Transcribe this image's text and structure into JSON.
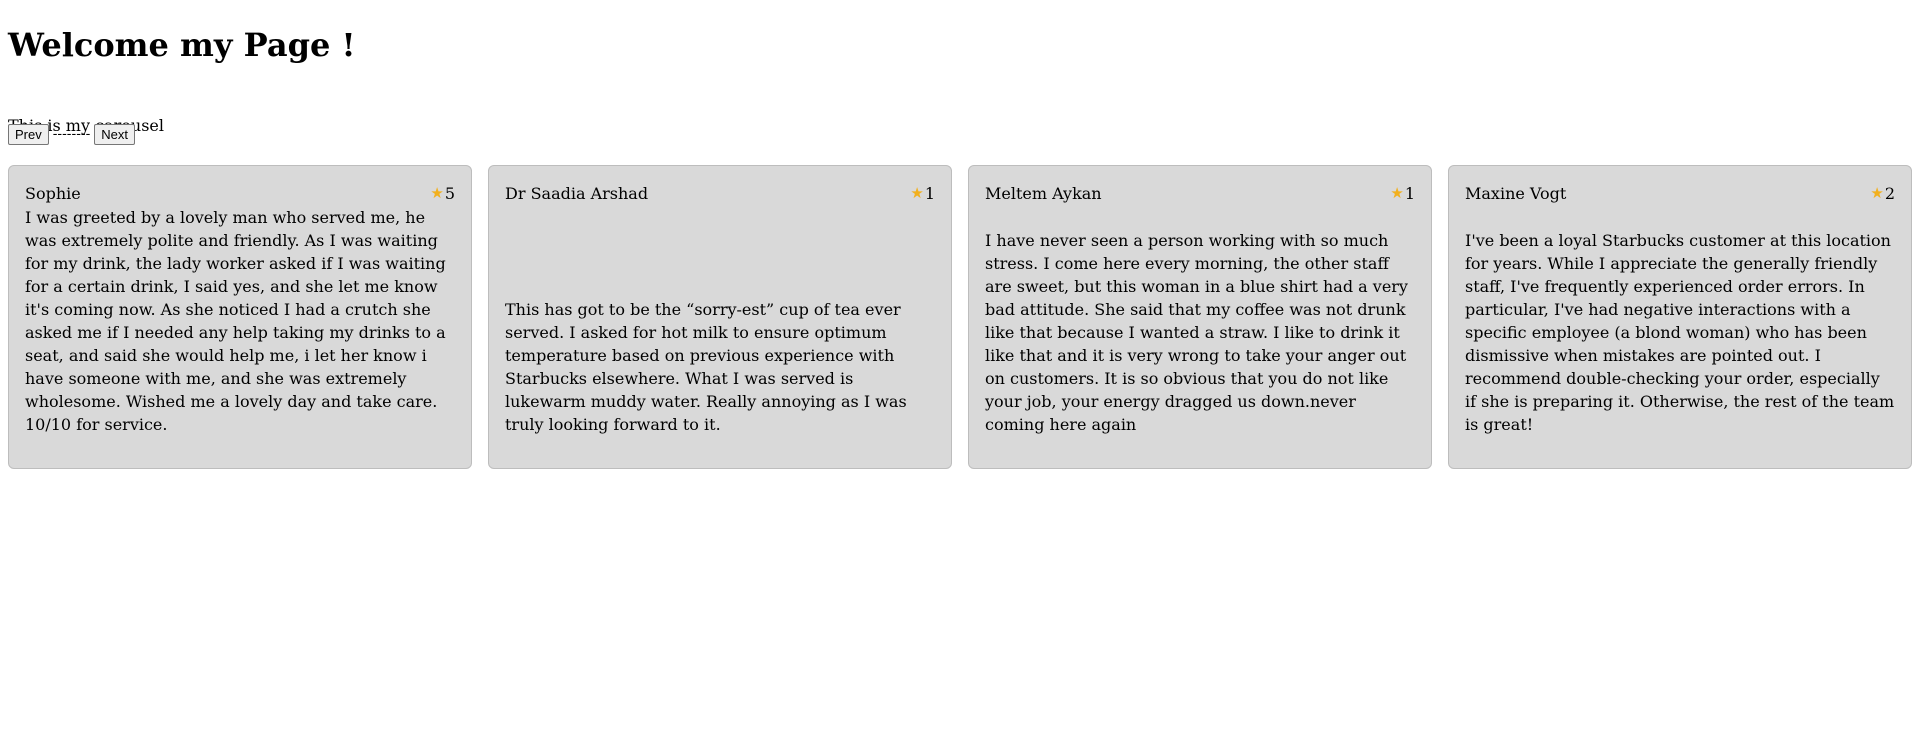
{
  "page": {
    "title": "Welcome my Page !",
    "subtitle": "This is my carousel"
  },
  "controls": {
    "prev_label": "Prev",
    "separator": "--------",
    "next_label": "Next"
  },
  "colors": {
    "card_background": "#d9d9d9",
    "star": "#f2b01e"
  },
  "reviews": [
    {
      "name": "Sophie",
      "star_icon": "star-icon",
      "rating": "5",
      "text": "I was greeted by a lovely man who served me, he was extremely polite and friendly. As I was waiting for my drink, the lady worker asked if I was waiting for a certain drink, I said yes, and she let me know it's coming now. As she noticed I had a crutch she asked me if I needed any help taking my drinks to a seat, and said she would help me, i let her know i have someone with me, and she was extremely wholesome. Wished me a lovely day and take care. 10/10 for service."
    },
    {
      "name": "Dr Saadia Arshad",
      "star_icon": "star-icon",
      "rating": "1",
      "text": "This has got to be the “sorry-est” cup of tea ever served. I asked for hot milk to ensure optimum temperature based on previous experience with Starbucks elsewhere. What I was served is lukewarm muddy water. Really annoying as I was truly looking forward to it."
    },
    {
      "name": "Meltem Aykan",
      "star_icon": "star-icon",
      "rating": "1",
      "text": "I have never seen a person working with so much stress. I come here every morning, the other staff are sweet, but this woman in a blue shirt had a very bad attitude. She said that my coffee was not drunk like that because I wanted a straw. I like to drink it like that and it is very wrong to take your anger out on customers. It is so obvious that you do not like your job, your energy dragged us down.never coming here again"
    },
    {
      "name": "Maxine Vogt",
      "star_icon": "star-icon",
      "rating": "2",
      "text": "I've been a loyal Starbucks customer at this location for years. While I appreciate the generally friendly staff, I've frequently experienced order errors. In particular, I've had negative interactions with a specific employee (a blond woman) who has been dismissive when mistakes are pointed out. I recommend double-checking your order, especially if she is preparing it. Otherwise, the rest of the team is great!"
    }
  ]
}
